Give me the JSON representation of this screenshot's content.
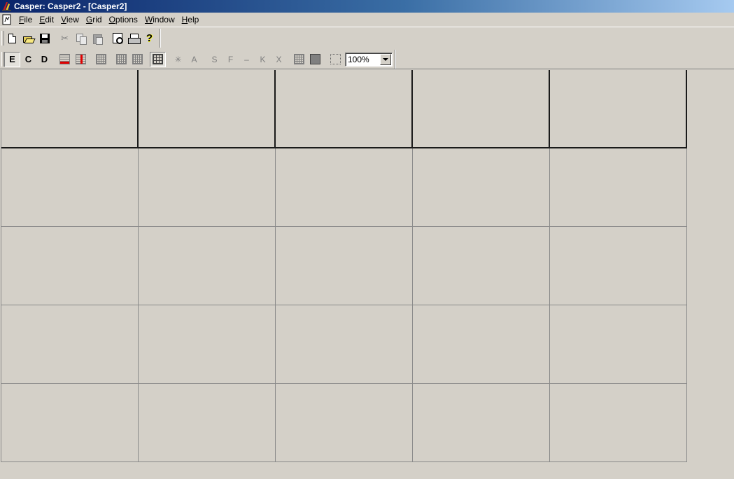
{
  "window": {
    "title": "Casper: Casper2 - [Casper2]"
  },
  "menu": [
    {
      "label": "File",
      "accel": "F",
      "rest": "ile",
      "name": "menu-file"
    },
    {
      "label": "Edit",
      "accel": "E",
      "rest": "dit",
      "name": "menu-edit"
    },
    {
      "label": "View",
      "accel": "V",
      "rest": "iew",
      "name": "menu-view"
    },
    {
      "label": "Grid",
      "accel": "G",
      "rest": "rid",
      "name": "menu-grid"
    },
    {
      "label": "Options",
      "accel": "O",
      "rest": "ptions",
      "name": "menu-options"
    },
    {
      "label": "Window",
      "accel": "W",
      "rest": "indow",
      "name": "menu-window"
    },
    {
      "label": "Help",
      "accel": "H",
      "rest": "elp",
      "name": "menu-help"
    }
  ],
  "toolbar2": {
    "e_label": "E",
    "c_label": "C",
    "d_label": "D",
    "star_label": "✳",
    "a_label": "A",
    "s_label": "S",
    "f_label": "F",
    "dash_label": "–",
    "k_label": "K",
    "x_label": "X",
    "zoom_value": "100%"
  },
  "grid": {
    "columns": 5,
    "rows": 5
  },
  "colors": {
    "face": "#d4d0c8",
    "title_start": "#0a246a",
    "title_end": "#a6caf0"
  }
}
